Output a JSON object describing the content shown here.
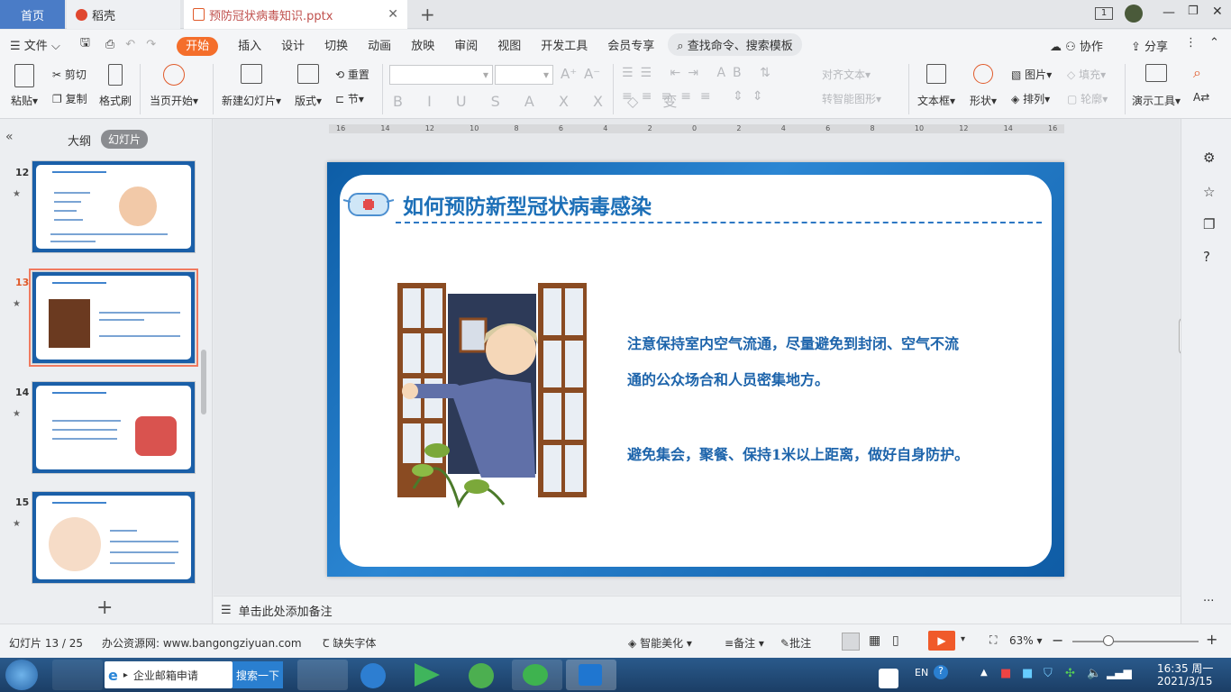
{
  "tabs": {
    "home": "首页",
    "wps": "稻壳",
    "doc": "预防冠状病毒知识.pptx",
    "page_indicator": "1"
  },
  "menu": {
    "file": "文件",
    "items": [
      "开始",
      "插入",
      "设计",
      "切换",
      "动画",
      "放映",
      "审阅",
      "视图",
      "开发工具",
      "会员专享"
    ],
    "search": "查找命令、搜索模板",
    "collab": "协作",
    "share": "分享"
  },
  "ribbon": {
    "paste": "粘贴",
    "cut": "剪切",
    "copy": "复制",
    "format_painter": "格式刷",
    "from_current": "当页开始",
    "new_slide": "新建幻灯片",
    "layout": "版式",
    "reset": "重置",
    "section": "节",
    "align_text": "对齐文本",
    "smart_art": "转智能图形",
    "textbox": "文本框",
    "shape": "形状",
    "picture": "图片",
    "fill": "填充",
    "arrange": "排列",
    "outline": "轮廓",
    "present_tools": "演示工具"
  },
  "panel": {
    "outline_tab": "大纲",
    "slides_tab": "幻灯片",
    "slide_numbers": [
      "12",
      "13",
      "14",
      "15"
    ]
  },
  "slide": {
    "title": "如何预防新型冠状病毒感染",
    "para1_line1": "注意保持室内空气流通，尽量避免到封闭、空气不流",
    "para1_line2": "通的公众场合和人员密集地方。",
    "para2": "避免集会，聚餐、保持1米以上距离，做好自身防护。"
  },
  "ruler": {
    "labels": [
      "16",
      "14",
      "12",
      "10",
      "8",
      "6",
      "4",
      "2",
      "0",
      "2",
      "4",
      "6",
      "8",
      "10",
      "12",
      "14",
      "16"
    ]
  },
  "notes": {
    "placeholder": "单击此处添加备注"
  },
  "status": {
    "slide_pos": "幻灯片 13 / 25",
    "site": "办公资源网: www.bangongziyuan.com",
    "missing_font": "缺失字体",
    "beautify": "智能美化",
    "notes": "备注",
    "comments": "批注",
    "zoom": "63%"
  },
  "taskbar": {
    "ie_text": "企业邮箱申请",
    "search_btn": "搜索一下",
    "lang": "EN",
    "time": "16:35 周一",
    "date": "2021/3/15"
  }
}
